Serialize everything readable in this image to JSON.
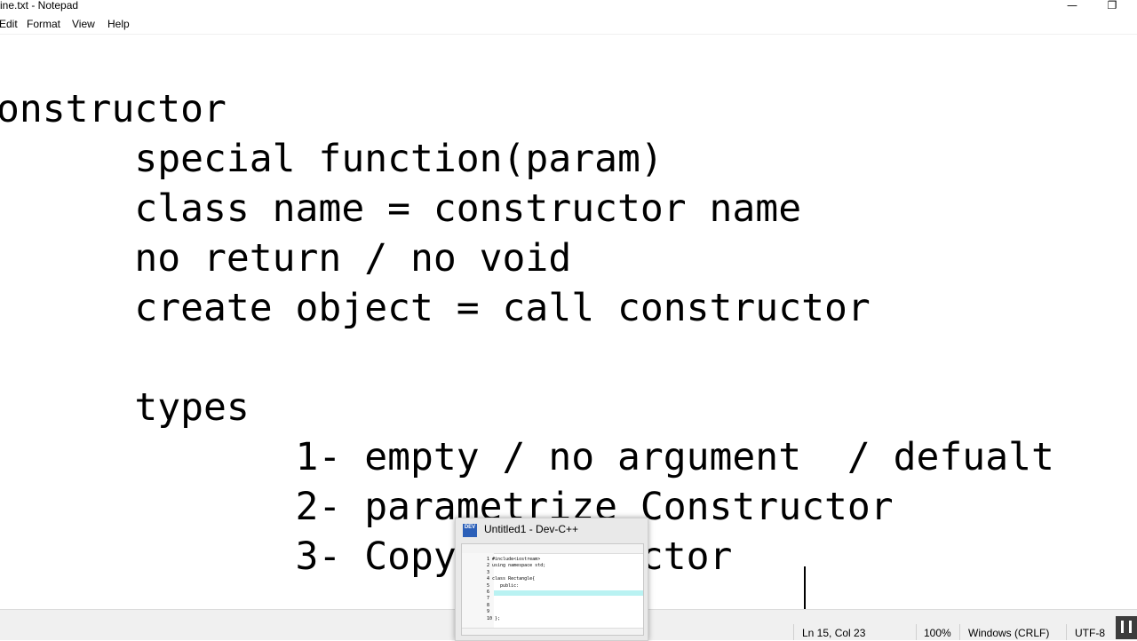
{
  "window": {
    "title": "tline.txt - Notepad",
    "minimize_glyph": "—",
    "restore_glyph": "❐"
  },
  "menu": {
    "items": [
      "Edit",
      "Format",
      "View",
      "Help"
    ]
  },
  "document": {
    "lines": [
      "onstructor",
      "      special function(param)",
      "      class name = constructor name",
      "      no return / no void",
      "      create object = call constructor",
      "",
      "      types",
      "             1- empty / no argument  / defualt",
      "             2- parametrize Constructor",
      "             3- Copy Constructor "
    ]
  },
  "status": {
    "position": "Ln 15, Col 23",
    "zoom": "100%",
    "line_ending": "Windows (CRLF)",
    "encoding": "UTF-8"
  },
  "preview": {
    "title": "Untitled1 - Dev-C++",
    "icon_text": "DEV",
    "code_lines": [
      "1 #include<iostream>",
      "2 using namespace std;",
      "3",
      "4 class Rectangle{",
      "5    public:",
      "6",
      "7",
      "8",
      "9",
      "10 };"
    ]
  }
}
